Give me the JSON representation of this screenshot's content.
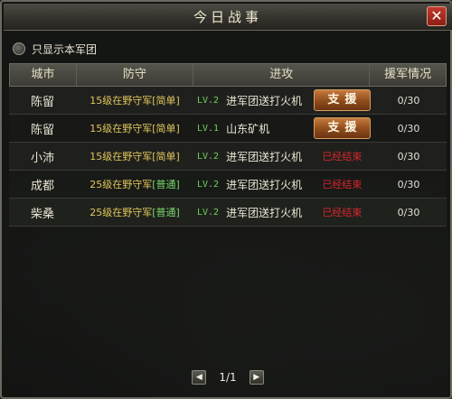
{
  "dialog": {
    "title": "今日战事",
    "close_icon": "close-icon"
  },
  "filter": {
    "label": "只显示本军团",
    "checked": false
  },
  "table": {
    "headers": {
      "city": "城市",
      "defense": "防守",
      "attack": "进攻",
      "support": "援军情况"
    },
    "rows": [
      {
        "city": "陈留",
        "defense_prefix": "15级在野守军",
        "defense_diff": "[简单]",
        "diff_type": "easy",
        "attack_level": "LV.2",
        "attack_name": "进军团送打火机",
        "action": "支援",
        "action_type": "button",
        "support_count": "0/30"
      },
      {
        "city": "陈留",
        "defense_prefix": "15级在野守军",
        "defense_diff": "[简单]",
        "diff_type": "easy",
        "attack_level": "LV.1",
        "attack_name": "山东矿机",
        "action": "支援",
        "action_type": "button",
        "support_count": "0/30"
      },
      {
        "city": "小沛",
        "defense_prefix": "15级在野守军",
        "defense_diff": "[简单]",
        "diff_type": "easy",
        "attack_level": "LV.2",
        "attack_name": "进军团送打火机",
        "action": "已经结束",
        "action_type": "status",
        "support_count": "0/30"
      },
      {
        "city": "成都",
        "defense_prefix": "25级在野守军",
        "defense_diff": "[普通]",
        "diff_type": "normal",
        "attack_level": "LV.2",
        "attack_name": "进军团送打火机",
        "action": "已经结束",
        "action_type": "status",
        "support_count": "0/30"
      },
      {
        "city": "柴桑",
        "defense_prefix": "25级在野守军",
        "defense_diff": "[普通]",
        "diff_type": "normal",
        "attack_level": "LV.2",
        "attack_name": "进军团送打火机",
        "action": "已经结束",
        "action_type": "status",
        "support_count": "0/30"
      }
    ]
  },
  "pager": {
    "label": "1/1",
    "prev_icon": "prev-page-icon",
    "next_icon": "next-page-icon"
  },
  "colors": {
    "easy": "#e2c65c",
    "normal": "#76d66a",
    "level": "#6ed25a",
    "ended": "#d8262c",
    "button": "#b06a30"
  }
}
